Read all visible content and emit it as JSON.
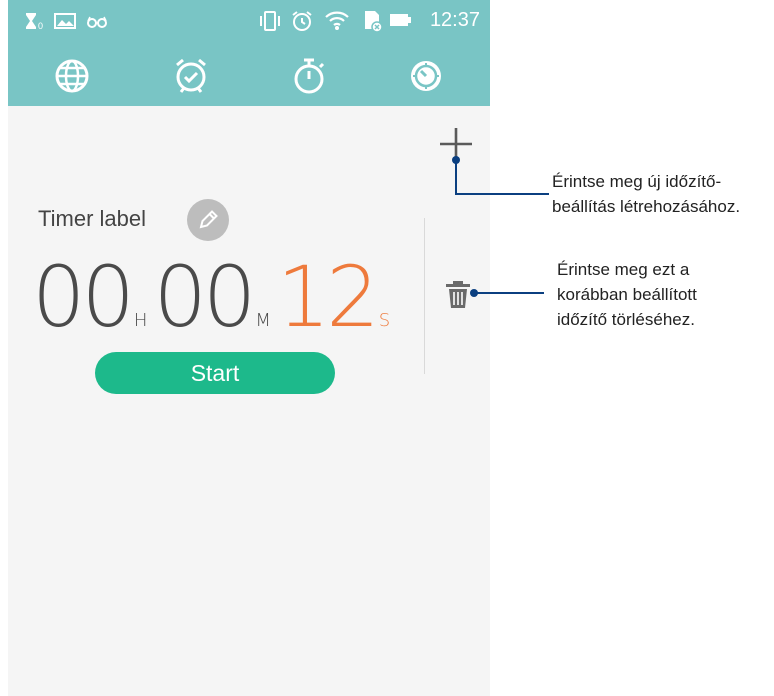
{
  "status_bar": {
    "left_icons": [
      "hourglass-icon",
      "image-icon",
      "glasses-icon"
    ],
    "right_icons": [
      "vibrate-icon",
      "alarm-icon",
      "wifi-icon",
      "sd-card-icon",
      "battery-icon"
    ],
    "time": "12:37",
    "hourglass_sub": "0"
  },
  "tabs": [
    {
      "name": "world-clock",
      "icon": "globe-icon"
    },
    {
      "name": "alarm",
      "icon": "alarm-clock-icon"
    },
    {
      "name": "stopwatch",
      "icon": "stopwatch-icon"
    },
    {
      "name": "timer",
      "icon": "timer-icon",
      "active": true
    }
  ],
  "timer": {
    "label": "Timer label",
    "hours": "00",
    "hours_unit": "H",
    "minutes": "00",
    "minutes_unit": "M",
    "seconds": "12",
    "seconds_unit": "S",
    "start_label": "Start"
  },
  "colors": {
    "header": "#79c5c5",
    "accent_orange": "#ee7a3c",
    "start_green": "#1db98b",
    "callout_line": "#0b3f80"
  },
  "callouts": {
    "add": [
      "Érintse meg új időzítő-",
      "beállítás létrehozásához."
    ],
    "delete": [
      "Érintse meg ezt a",
      "korábban beállított",
      "időzítő törléséhez."
    ]
  }
}
